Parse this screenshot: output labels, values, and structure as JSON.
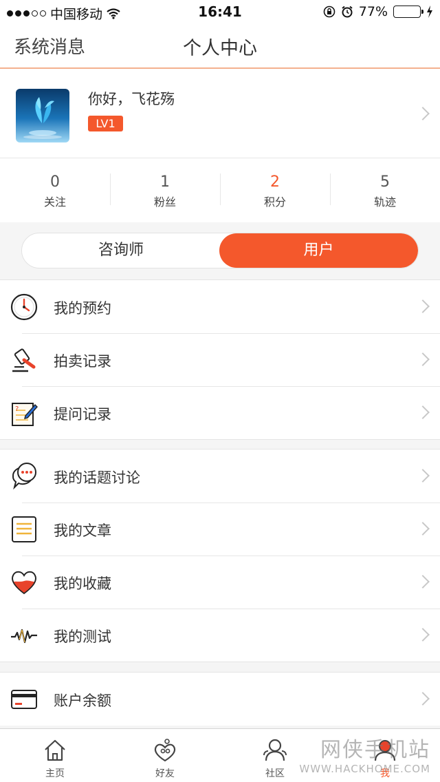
{
  "status_bar": {
    "carrier": "中国移动",
    "time": "16:41",
    "battery": "77%"
  },
  "nav": {
    "left_label": "系统消息",
    "title": "个人中心"
  },
  "profile": {
    "greeting": "你好，飞花殇",
    "level": "LV1"
  },
  "stats": [
    {
      "value": "0",
      "label": "关注"
    },
    {
      "value": "1",
      "label": "粉丝"
    },
    {
      "value": "2",
      "label": "积分"
    },
    {
      "value": "5",
      "label": "轨迹"
    }
  ],
  "segment": {
    "left": "咨询师",
    "right": "用户",
    "selected": "用户"
  },
  "menu_groups": [
    [
      {
        "label": "我的预约",
        "icon": "clock-icon"
      },
      {
        "label": "拍卖记录",
        "icon": "gavel-icon"
      },
      {
        "label": "提问记录",
        "icon": "question-note-icon"
      }
    ],
    [
      {
        "label": "我的话题讨论",
        "icon": "chat-bubbles-icon"
      },
      {
        "label": "我的文章",
        "icon": "article-icon"
      },
      {
        "label": "我的收藏",
        "icon": "heart-icon"
      },
      {
        "label": "我的测试",
        "icon": "pulse-icon"
      }
    ],
    [
      {
        "label": "账户余额",
        "icon": "card-icon"
      }
    ]
  ],
  "tabbar": [
    {
      "label": "主页",
      "icon": "home-icon"
    },
    {
      "label": "好友",
      "icon": "friends-icon"
    },
    {
      "label": "社区",
      "icon": "community-icon"
    },
    {
      "label": "我",
      "icon": "me-icon"
    }
  ],
  "watermark": {
    "text": "网侠手机站",
    "url": "WWW.HACKHOME.COM"
  },
  "colors": {
    "accent": "#f4582c"
  }
}
